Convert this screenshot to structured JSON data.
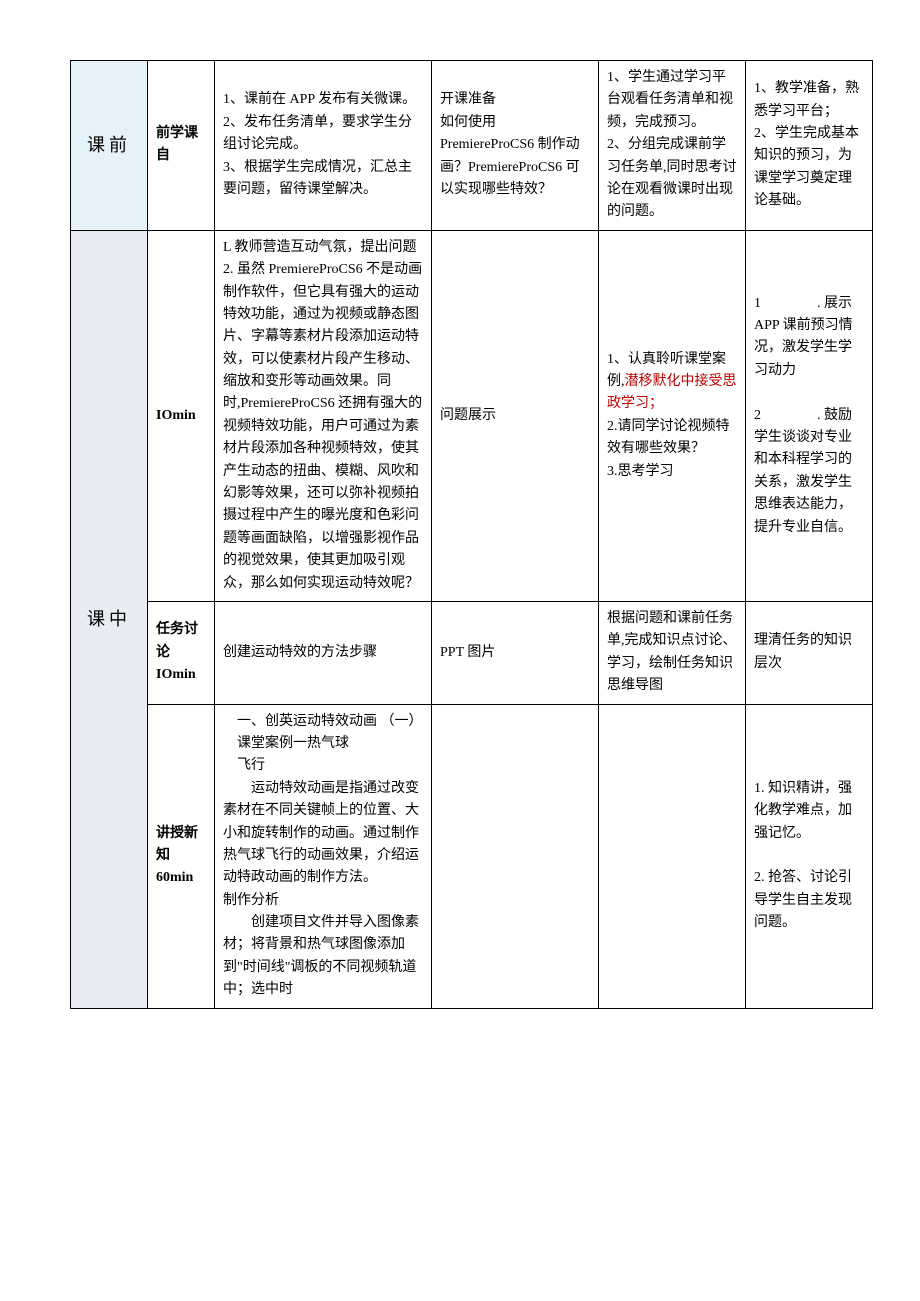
{
  "rows": {
    "pre": {
      "phase": "课前",
      "stage": "前学课自",
      "content": "1、课前在 APP 发布有关微课。\n2、发布任务清单，要求学生分组讨论完成。\n3、根据学生完成情况，汇总主要问题，留待课堂解决。",
      "question": "开课准备\n如何使用 PremiereProCS6 制作动画？PremiereProCS6 可以实现哪些特效？",
      "student": "1、学生通过学习平台观看任务清单和视频，完成预习。\n2、分组完成课前学习任务单,同时思考讨论在观看微课时出现的问题。",
      "purpose": "1、教学准备，熟悉学习平台；\n2、学生完成基本知识的预习，为课堂学习奠定理论基础。"
    },
    "mid1": {
      "phase": "课中",
      "stage": "IOmin",
      "content": "L 教师营造互动气氛，提出问题\n2. 虽然 PremiereProCS6 不是动画制作软件，但它具有强大的运动特效功能，通过为视频或静态图片、字幕等素材片段添加运动特效，可以使素材片段产生移动、缩放和变形等动画效果。同时,PremiereProCS6 还拥有强大的视频特效功能，用户可通过为素材片段添加各种视频特效，使其产生动态的扭曲、模糊、风吹和幻影等效果，还可以弥补视频拍摄过程中产生的曝光度和色彩问题等画面缺陷，以增强影视作品的视觉效果，使其更加吸引观众，那么如何实现运动特效呢？",
      "question": "问题展示",
      "student_p1": "1、认真聆听课堂案例,",
      "student_hl": "潜移默化中接受思政学习；",
      "student_p2": "2.请同学讨论视频特效有哪些效果？\n3.思考学习",
      "purpose_p1": "1　　　　. 展示 APP 课前预习情况，激发学生学习动力",
      "purpose_p2": "2　　　　. 鼓励学生谈谈对专业和本科程学习的关系，激发学生思维表达能力，提升专业自信。"
    },
    "mid2": {
      "stage": "任务讨论IOmin",
      "content": "创建运动特效的方法步骤",
      "question": "PPT 图片",
      "student": "根据问题和课前任务单,完成知识点讨论、学习，绘制任务知识思维导图",
      "purpose": "理清任务的知识层次"
    },
    "mid3": {
      "stage": "讲授新知60min",
      "content_p1": "一、创英运动特效动画 （一）课堂案例一热气球\n飞行",
      "content_p2": "运动特效动画是指通过改变素材在不同关键帧上的位置、大小和旋转制作的动画。通过制作热气球飞行的动画效果，介绍运动特政动画的制作方法。\n制作分析",
      "content_p3": "创建项目文件并导入图像素材；将背景和热气球图像添加到\"时间线\"调板的不同视频轨道中；选中时",
      "question": "",
      "student": "",
      "purpose": "1. 知识精讲，强化教学难点，加强记忆。\n\n2. 抢答、讨论引导学生自主发现问题。"
    }
  }
}
